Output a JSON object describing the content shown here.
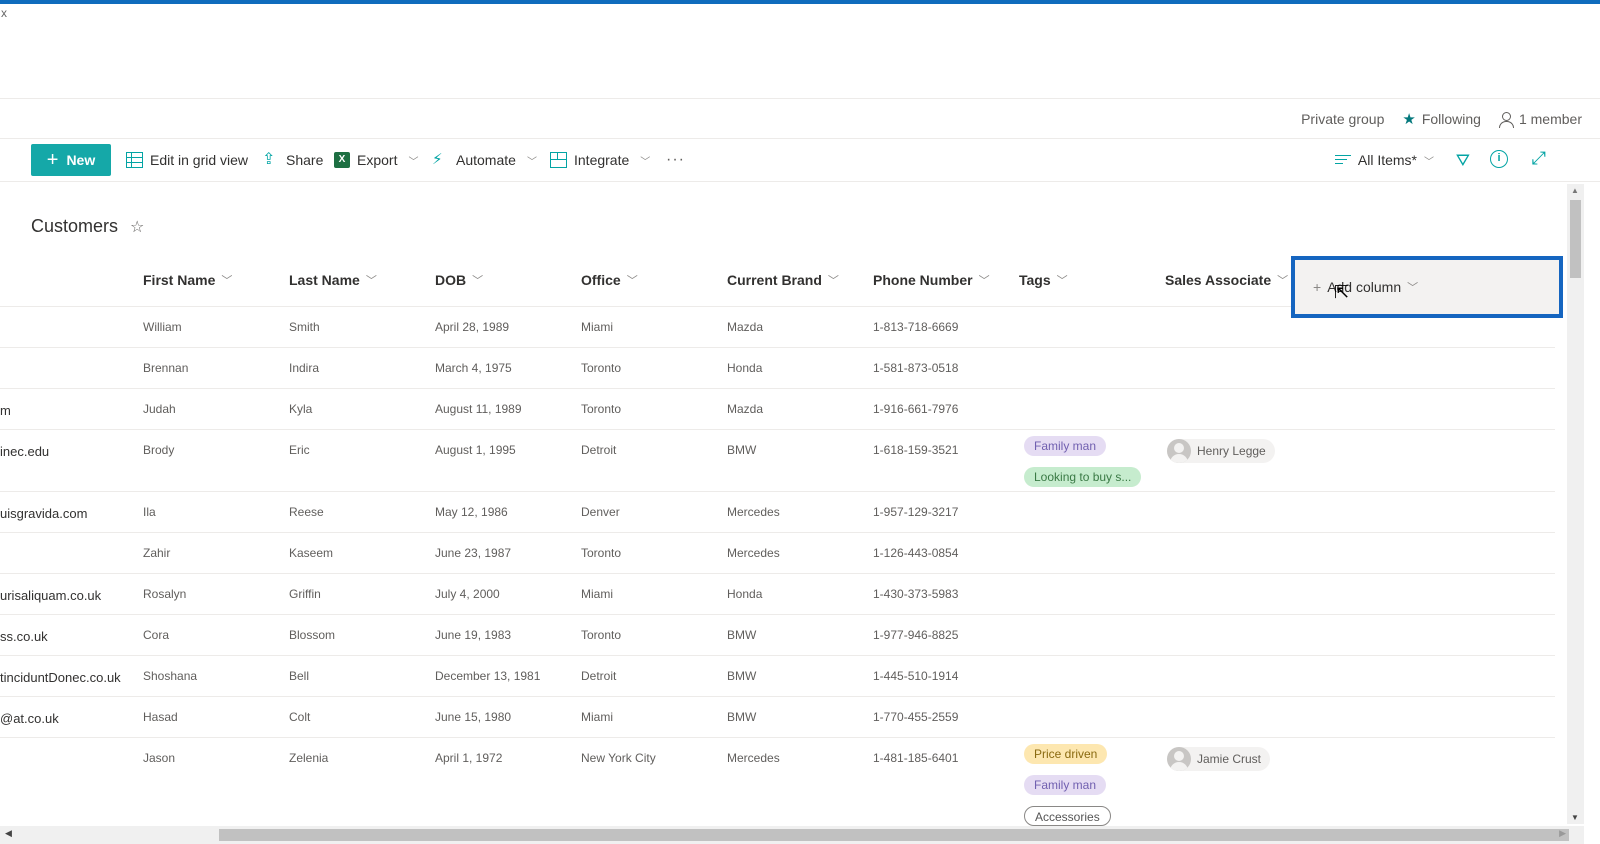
{
  "window": {
    "close_glyph": "x",
    "accent_color": "#0f6cbd"
  },
  "group_info": {
    "privacy": "Private group",
    "following": "Following",
    "members": "1 member"
  },
  "command_bar": {
    "new_label": "New",
    "edit_grid_label": "Edit in grid view",
    "share_label": "Share",
    "export_label": "Export",
    "automate_label": "Automate",
    "integrate_label": "Integrate",
    "more_label": "···",
    "view_label": "All Items*",
    "brand_color": "#03a4a4"
  },
  "list": {
    "title": "Customers",
    "columns": [
      "First Name",
      "Last Name",
      "DOB",
      "Office",
      "Current Brand",
      "Phone Number",
      "Tags",
      "Sales Associate"
    ],
    "add_column_label": "Add column",
    "rows": [
      {
        "email": "",
        "first": "William",
        "last": "Smith",
        "dob": "April 28, 1989",
        "office": "Miami",
        "brand": "Mazda",
        "phone": "1-813-718-6669",
        "tags": [],
        "associate": ""
      },
      {
        "email": "",
        "first": "Brennan",
        "last": "Indira",
        "dob": "March 4, 1975",
        "office": "Toronto",
        "brand": "Honda",
        "phone": "1-581-873-0518",
        "tags": [],
        "associate": ""
      },
      {
        "email": "m",
        "first": "Judah",
        "last": "Kyla",
        "dob": "August 11, 1989",
        "office": "Toronto",
        "brand": "Mazda",
        "phone": "1-916-661-7976",
        "tags": [],
        "associate": ""
      },
      {
        "email": "inec.edu",
        "first": "Brody",
        "last": "Eric",
        "dob": "August 1, 1995",
        "office": "Detroit",
        "brand": "BMW",
        "phone": "1-618-159-3521",
        "tags": [
          "Family man",
          "Looking to buy s..."
        ],
        "associate": "Henry Legge"
      },
      {
        "email": "uisgravida.com",
        "first": "Ila",
        "last": "Reese",
        "dob": "May 12, 1986",
        "office": "Denver",
        "brand": "Mercedes",
        "phone": "1-957-129-3217",
        "tags": [],
        "associate": ""
      },
      {
        "email": "",
        "first": "Zahir",
        "last": "Kaseem",
        "dob": "June 23, 1987",
        "office": "Toronto",
        "brand": "Mercedes",
        "phone": "1-126-443-0854",
        "tags": [],
        "associate": ""
      },
      {
        "email": "urisaliquam.co.uk",
        "first": "Rosalyn",
        "last": "Griffin",
        "dob": "July 4, 2000",
        "office": "Miami",
        "brand": "Honda",
        "phone": "1-430-373-5983",
        "tags": [],
        "associate": ""
      },
      {
        "email": "ss.co.uk",
        "first": "Cora",
        "last": "Blossom",
        "dob": "June 19, 1983",
        "office": "Toronto",
        "brand": "BMW",
        "phone": "1-977-946-8825",
        "tags": [],
        "associate": ""
      },
      {
        "email": "tinciduntDonec.co.uk",
        "first": "Shoshana",
        "last": "Bell",
        "dob": "December 13, 1981",
        "office": "Detroit",
        "brand": "BMW",
        "phone": "1-445-510-1914",
        "tags": [],
        "associate": ""
      },
      {
        "email": "@at.co.uk",
        "first": "Hasad",
        "last": "Colt",
        "dob": "June 15, 1980",
        "office": "Miami",
        "brand": "BMW",
        "phone": "1-770-455-2559",
        "tags": [],
        "associate": ""
      },
      {
        "email": "",
        "first": "Jason",
        "last": "Zelenia",
        "dob": "April 1, 1972",
        "office": "New York City",
        "brand": "Mercedes",
        "phone": "1-481-185-6401",
        "tags": [
          "Price driven",
          "Family man",
          "Accessories"
        ],
        "associate": "Jamie Crust"
      }
    ]
  },
  "tag_colors": {
    "Family man": "purple",
    "Looking to buy s...": "green",
    "Price driven": "yellow",
    "Accessories": "outline"
  }
}
